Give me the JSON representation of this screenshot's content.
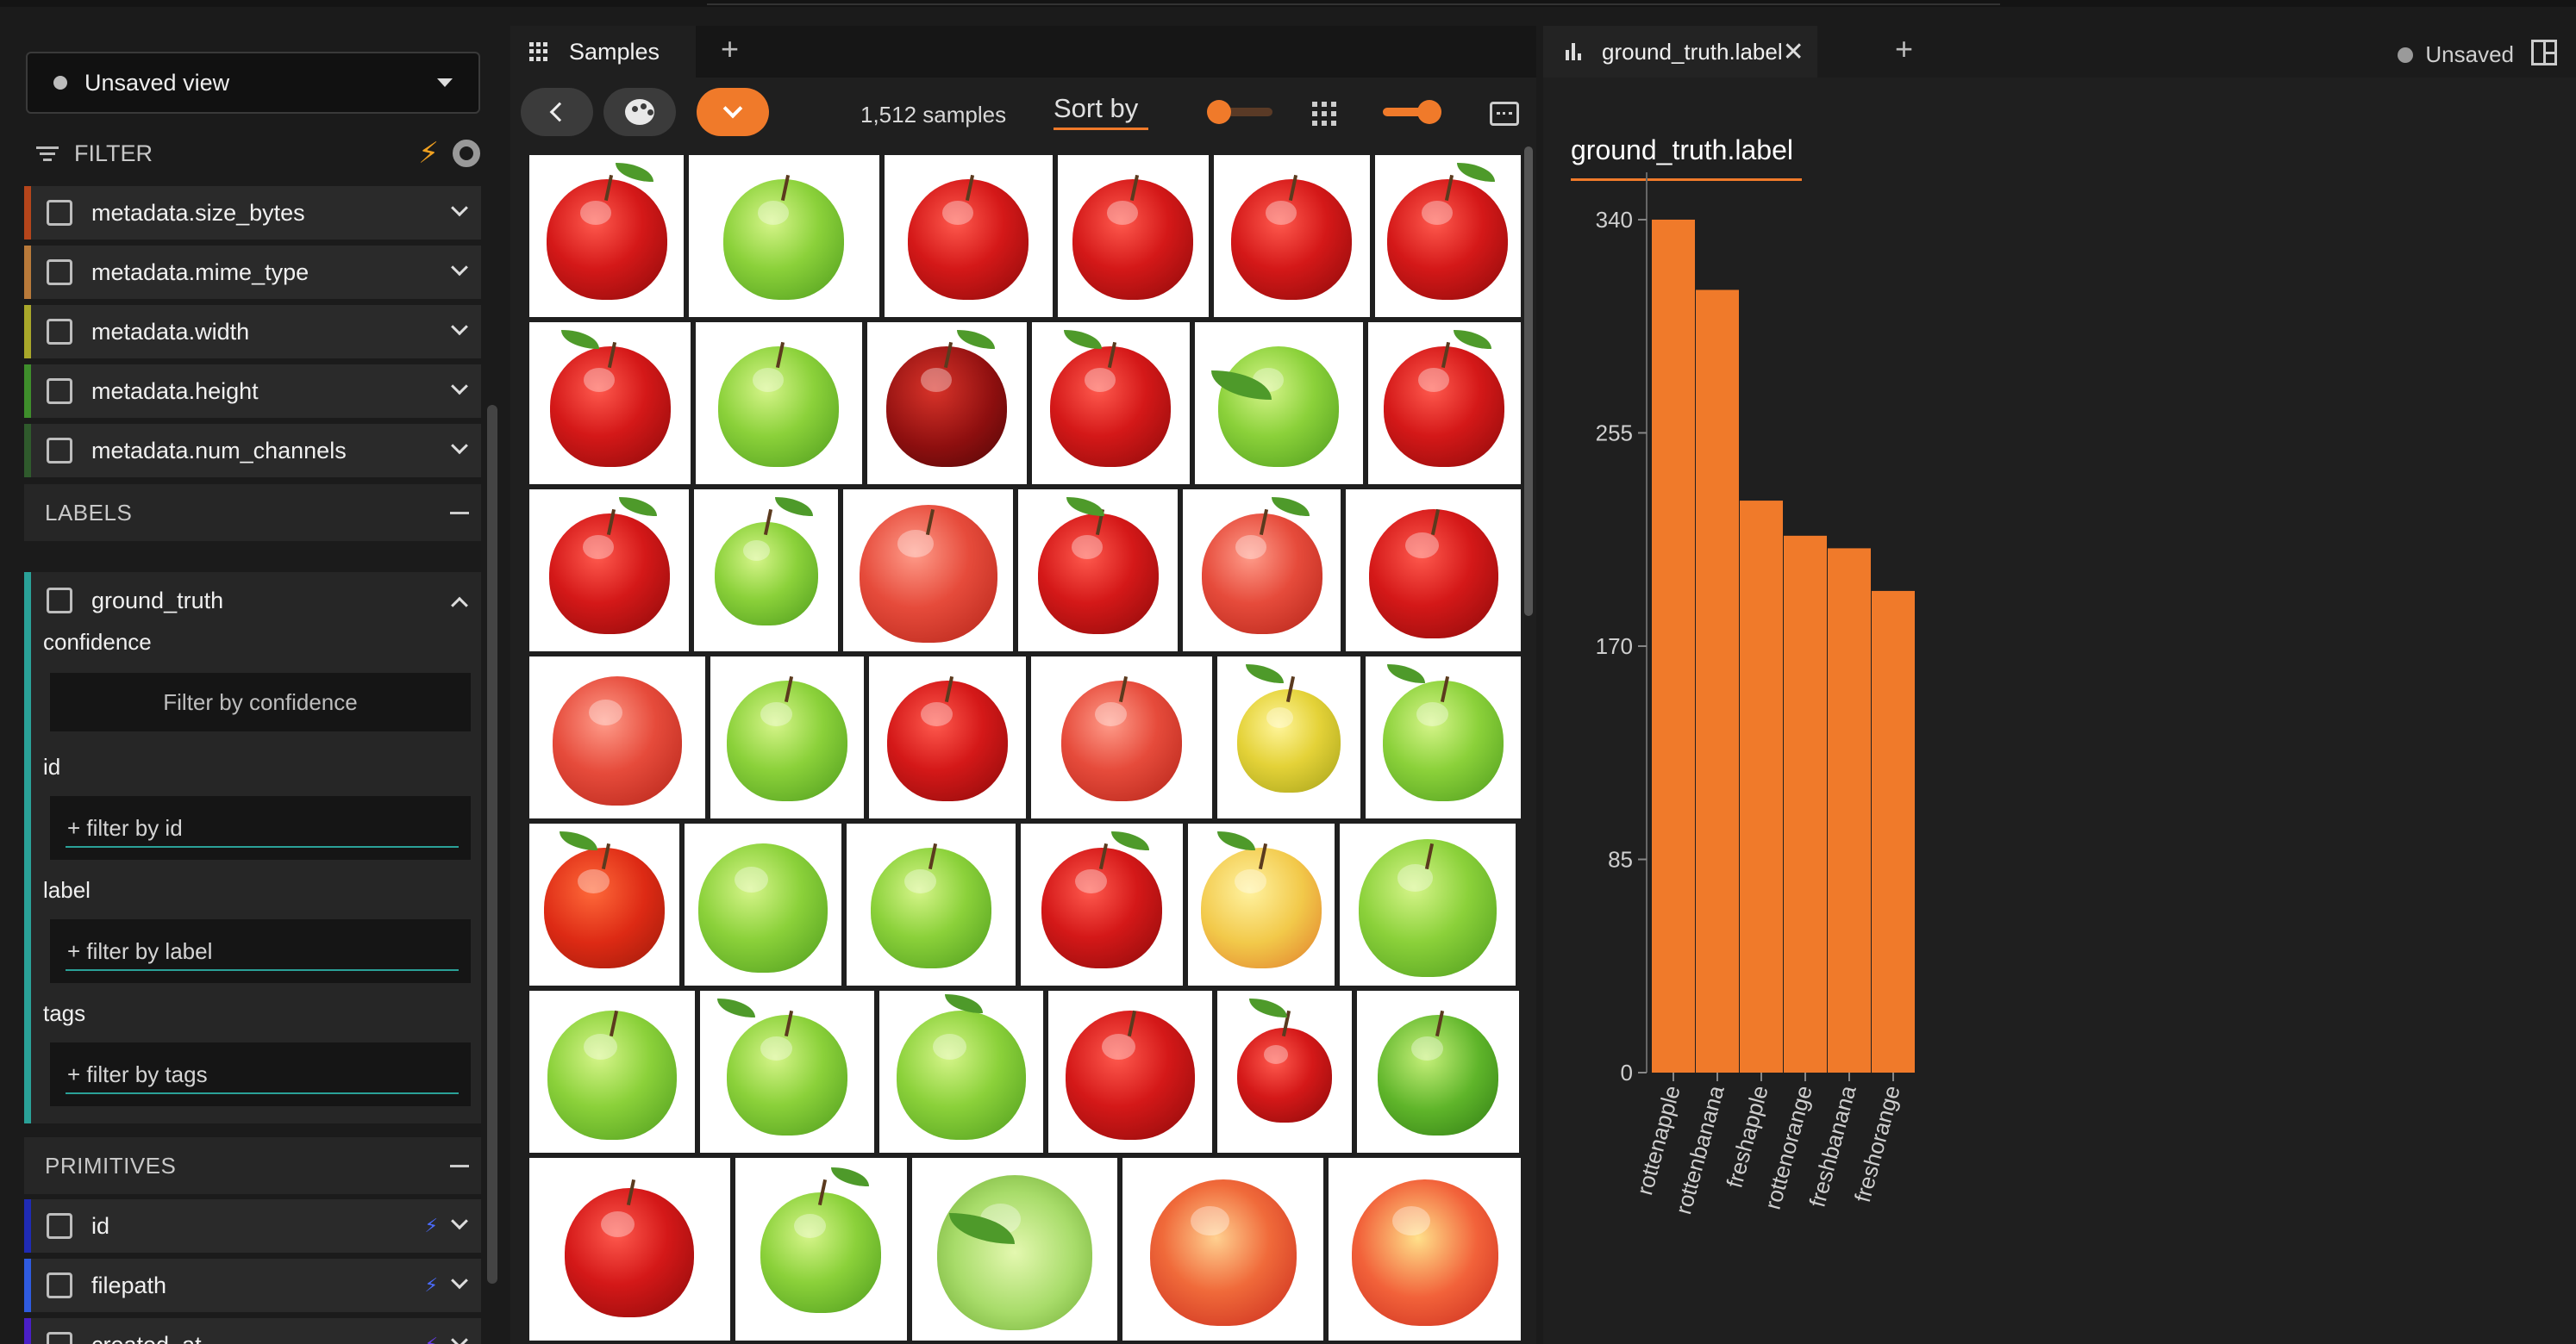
{
  "sidebar": {
    "view_label": "Unsaved view",
    "filter_label": "FILTER",
    "fields": [
      {
        "label": "metadata.size_bytes",
        "color": "#b5451b"
      },
      {
        "label": "metadata.mime_type",
        "color": "#b97a3a"
      },
      {
        "label": "metadata.width",
        "color": "#a9a82a"
      },
      {
        "label": "metadata.height",
        "color": "#3e8e2b"
      },
      {
        "label": "metadata.num_channels",
        "color": "#2f5a2c"
      }
    ],
    "labels_section": "LABELS",
    "ground_truth": {
      "label": "ground_truth",
      "color": "#2aa198",
      "confidence_label": "confidence",
      "confidence_placeholder": "Filter by confidence",
      "id_label": "id",
      "id_placeholder": "+ filter by id",
      "label_label": "label",
      "label_placeholder": "+ filter by label",
      "tags_label": "tags",
      "tags_placeholder": "+ filter by tags"
    },
    "primitives_section": "PRIMITIVES",
    "primitives": [
      {
        "label": "id",
        "color": "#1f2bb5"
      },
      {
        "label": "filepath",
        "color": "#2f5be0"
      },
      {
        "label": "created_at",
        "color": "#4a1fc7"
      }
    ]
  },
  "samples": {
    "tab_label": "Samples",
    "count": "1,512 samples",
    "sort_label": "Sort by"
  },
  "chart_panel": {
    "tab_label": "ground_truth.label",
    "status": "Unsaved",
    "title": "ground_truth.label"
  },
  "chart_data": {
    "type": "bar",
    "title": "ground_truth.label",
    "categories": [
      "rottenapple",
      "rottenbanana",
      "freshapple",
      "rottenorange",
      "freshbanana",
      "freshorange"
    ],
    "values": [
      340,
      312,
      228,
      214,
      209,
      192
    ],
    "yticks": [
      0,
      85,
      170,
      255,
      340
    ],
    "ylim": [
      0,
      352
    ],
    "bar_color": "#f07a2a",
    "grid": false,
    "legend": "none"
  }
}
